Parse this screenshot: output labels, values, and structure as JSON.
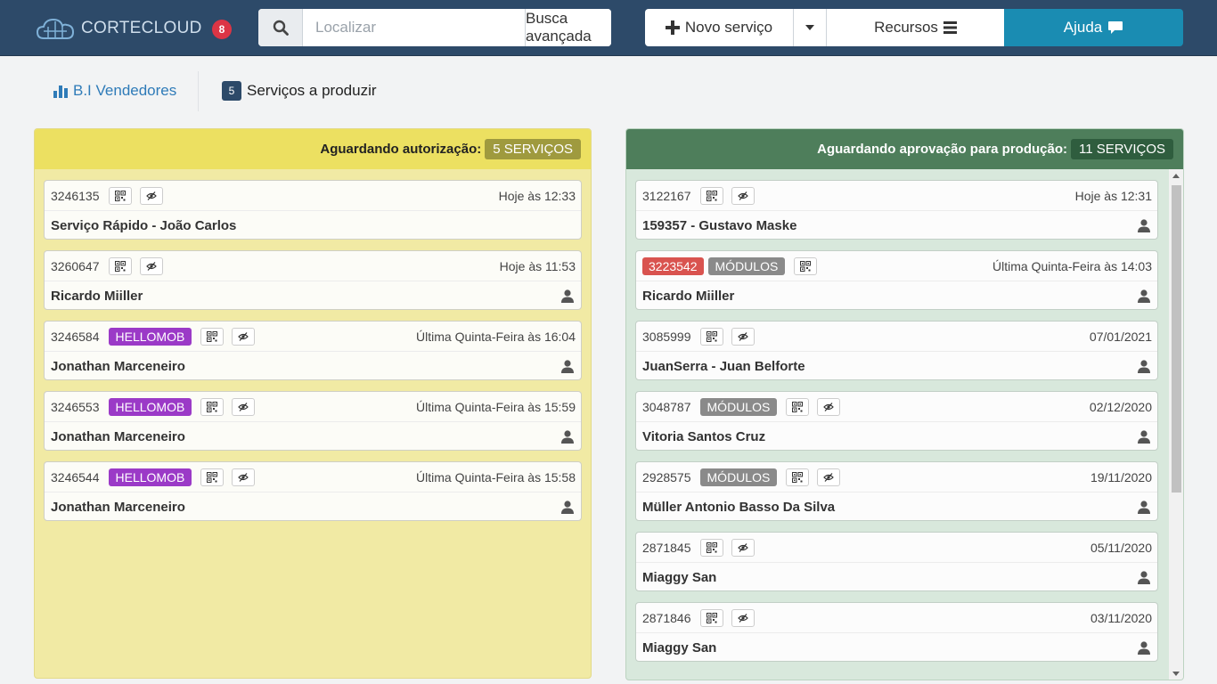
{
  "header": {
    "brand": "CORTECLOUD",
    "notification_count": "8",
    "search_placeholder": "Localizar",
    "advanced_search": "Busca avançada",
    "new_service": "Novo serviço",
    "resources": "Recursos",
    "help": "Ajuda"
  },
  "subnav": {
    "bi": "B.I Vendedores",
    "services_count": "5",
    "services": "Serviços a produzir"
  },
  "columns": {
    "left": {
      "title": "Aguardando autorização:",
      "count": "5 SERVIÇOS",
      "cards": [
        {
          "id": "3246135",
          "tag": "",
          "time": "Hoje às 12:33",
          "name": "Serviço Rápido - João Carlos"
        },
        {
          "id": "3260647",
          "tag": "",
          "time": "Hoje às 11:53",
          "name": "Ricardo Miiller"
        },
        {
          "id": "3246584",
          "tag": "HELLOMOB",
          "time": "Última Quinta-Feira às 16:04",
          "name": "Jonathan Marceneiro"
        },
        {
          "id": "3246553",
          "tag": "HELLOMOB",
          "time": "Última Quinta-Feira às 15:59",
          "name": "Jonathan Marceneiro"
        },
        {
          "id": "3246544",
          "tag": "HELLOMOB",
          "time": "Última Quinta-Feira às 15:58",
          "name": "Jonathan Marceneiro"
        }
      ]
    },
    "right": {
      "title": "Aguardando aprovação para produção:",
      "count": "11 SERVIÇOS",
      "cards": [
        {
          "id": "3122167",
          "tag": "",
          "time": "Hoje às 12:31",
          "name": "159357 - Gustavo Maske"
        },
        {
          "id": "3223542",
          "tag": "MÓDULOS",
          "time": "Última Quinta-Feira às 14:03",
          "name": "Ricardo Miiller"
        },
        {
          "id": "3085999",
          "tag": "",
          "time": "07/01/2021",
          "name": "JuanSerra - Juan Belforte"
        },
        {
          "id": "3048787",
          "tag": "MÓDULOS",
          "time": "02/12/2020",
          "name": "Vitoria Santos Cruz"
        },
        {
          "id": "2928575",
          "tag": "MÓDULOS",
          "time": "19/11/2020",
          "name": "Müller Antonio Basso Da Silva"
        },
        {
          "id": "2871845",
          "tag": "",
          "time": "05/11/2020",
          "name": "Miaggy San"
        },
        {
          "id": "2871846",
          "tag": "",
          "time": "03/11/2020",
          "name": "Miaggy San"
        }
      ]
    }
  },
  "colors": {
    "header_bg": "#2d4a69",
    "help_btn": "#1a8cb2",
    "left_column_head": "#ece061",
    "right_column_head": "#4e7e5b",
    "hellomob_tag": "#9b3ac7",
    "modulos_tag": "#8a8a8a",
    "urgent_id": "#d9534f"
  }
}
